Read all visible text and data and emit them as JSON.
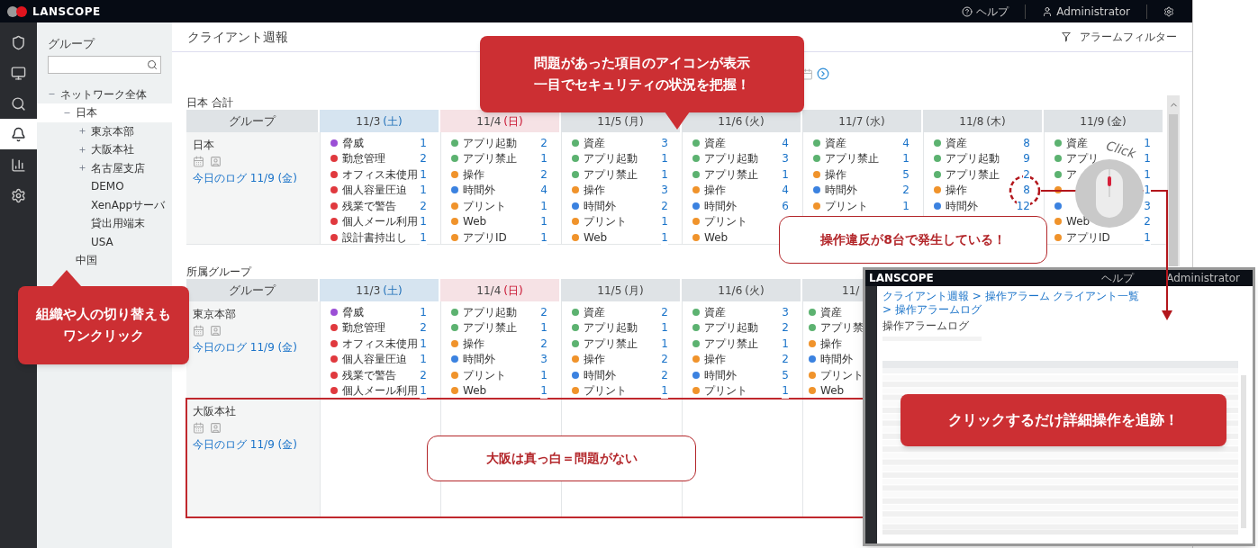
{
  "header": {
    "logo": "LANSCOPE",
    "help": "ヘルプ",
    "user": "Administrator"
  },
  "rail": [
    {
      "selected": false
    },
    {
      "selected": false
    },
    {
      "selected": false
    },
    {
      "selected": true
    },
    {
      "selected": false
    },
    {
      "selected": false
    }
  ],
  "group_panel": {
    "title": "グループ",
    "tree": [
      {
        "label": "ネットワーク全体",
        "expanded": true,
        "selected": false,
        "children": [
          {
            "label": "日本",
            "expanded": true,
            "selected": true,
            "children": [
              {
                "label": "東京本部",
                "expanded": false,
                "selected": false
              },
              {
                "label": "大阪本社",
                "expanded": false,
                "selected": false
              },
              {
                "label": "名古屋支店",
                "expanded": false,
                "selected": false
              },
              {
                "label": "DEMO",
                "selected": false
              },
              {
                "label": "XenAppサーバ",
                "selected": false
              },
              {
                "label": "貸出用端末",
                "selected": false
              },
              {
                "label": "USA",
                "selected": false
              }
            ]
          },
          {
            "label": "中国",
            "selected": false
          }
        ]
      }
    ]
  },
  "main": {
    "title": "クライアント週報",
    "filter": "アラームフィルター"
  },
  "sections": [
    {
      "title": "日本 合計",
      "group_heading": "グループ",
      "columns": [
        {
          "date": "11/3",
          "weekday": "(土)",
          "kind": "sat"
        },
        {
          "date": "11/4",
          "weekday": "(日)",
          "kind": "sun"
        },
        {
          "date": "11/5",
          "weekday": "(月)",
          "kind": "weekday"
        },
        {
          "date": "11/6",
          "weekday": "(火)",
          "kind": "weekday"
        },
        {
          "date": "11/7",
          "weekday": "(水)",
          "kind": "weekday"
        },
        {
          "date": "11/8",
          "weekday": "(木)",
          "kind": "weekday"
        },
        {
          "date": "11/9",
          "weekday": "(金)",
          "kind": "weekday"
        }
      ],
      "rows": [
        {
          "group": "日本",
          "link": "今日のログ 11/9 (金)",
          "highlighted": false,
          "cells": [
            [
              {
                "name": "脅威",
                "count": "1",
                "color": "#9b4fd6"
              },
              {
                "name": "勤怠管理",
                "count": "2",
                "color": "#e0393e"
              },
              {
                "name": "オフィス未使用",
                "count": "1",
                "color": "#e0393e"
              },
              {
                "name": "個人容量圧迫",
                "count": "1",
                "color": "#e0393e"
              },
              {
                "name": "残業で警告",
                "count": "2",
                "color": "#e0393e"
              },
              {
                "name": "個人メール利用",
                "count": "1",
                "color": "#e0393e"
              },
              {
                "name": "設計書持出し",
                "count": "1",
                "color": "#e0393e"
              }
            ],
            [
              {
                "name": "アプリ起動",
                "count": "2",
                "color": "#5cb270"
              },
              {
                "name": "アプリ禁止",
                "count": "1",
                "color": "#5cb270"
              },
              {
                "name": "操作",
                "count": "2",
                "color": "#f0932b"
              },
              {
                "name": "時間外",
                "count": "4",
                "color": "#3b82e0"
              },
              {
                "name": "プリント",
                "count": "1",
                "color": "#f0932b"
              },
              {
                "name": "Web",
                "count": "1",
                "color": "#f0932b"
              },
              {
                "name": "アプリID",
                "count": "1",
                "color": "#f0932b"
              }
            ],
            [
              {
                "name": "資産",
                "count": "3",
                "color": "#5cb270"
              },
              {
                "name": "アプリ起動",
                "count": "1",
                "color": "#5cb270"
              },
              {
                "name": "アプリ禁止",
                "count": "1",
                "color": "#5cb270"
              },
              {
                "name": "操作",
                "count": "3",
                "color": "#f0932b"
              },
              {
                "name": "時間外",
                "count": "2",
                "color": "#3b82e0"
              },
              {
                "name": "プリント",
                "count": "1",
                "color": "#f0932b"
              },
              {
                "name": "Web",
                "count": "1",
                "color": "#f0932b"
              }
            ],
            [
              {
                "name": "資産",
                "count": "4",
                "color": "#5cb270"
              },
              {
                "name": "アプリ起動",
                "count": "3",
                "color": "#5cb270"
              },
              {
                "name": "アプリ禁止",
                "count": "1",
                "color": "#5cb270"
              },
              {
                "name": "操作",
                "count": "4",
                "color": "#f0932b"
              },
              {
                "name": "時間外",
                "count": "6",
                "color": "#3b82e0"
              },
              {
                "name": "プリント",
                "color": "#f0932b"
              },
              {
                "name": "Web",
                "color": "#f0932b"
              }
            ],
            [
              {
                "name": "資産",
                "count": "4",
                "color": "#5cb270"
              },
              {
                "name": "アプリ禁止",
                "count": "1",
                "color": "#5cb270"
              },
              {
                "name": "操作",
                "count": "5",
                "color": "#f0932b"
              },
              {
                "name": "時間外",
                "count": "2",
                "color": "#3b82e0"
              },
              {
                "name": "プリント",
                "count": "1",
                "color": "#f0932b"
              }
            ],
            [
              {
                "name": "資産",
                "count": "8",
                "color": "#5cb270"
              },
              {
                "name": "アプリ起動",
                "count": "9",
                "color": "#5cb270"
              },
              {
                "name": "アプリ禁止",
                "count": "2",
                "color": "#5cb270"
              },
              {
                "name": "操作",
                "count": "8",
                "color": "#f0932b"
              },
              {
                "name": "時間外",
                "count": "12",
                "color": "#3b82e0"
              }
            ],
            [
              {
                "name": "資産",
                "count": "1",
                "color": "#5cb270"
              },
              {
                "name": "アプリ",
                "count": "1",
                "color": "#5cb270"
              },
              {
                "name": "ア",
                "count": "1",
                "color": "#5cb270"
              },
              {
                "count": "1",
                "color": "#f0932b"
              },
              {
                "count": "3",
                "color": "#3b82e0"
              },
              {
                "name": "Web",
                "count": "2",
                "color": "#f0932b"
              },
              {
                "name": "アプリID",
                "count": "1",
                "color": "#f0932b"
              }
            ]
          ]
        }
      ]
    },
    {
      "title": "所属グループ",
      "group_heading": "グループ",
      "columns": [
        {
          "date": "11/3",
          "weekday": "(土)",
          "kind": "sat"
        },
        {
          "date": "11/4",
          "weekday": "(日)",
          "kind": "sun"
        },
        {
          "date": "11/5",
          "weekday": "(月)",
          "kind": "weekday"
        },
        {
          "date": "11/6",
          "weekday": "(火)",
          "kind": "weekday"
        },
        {
          "date": "11/",
          "kind": "cut"
        }
      ],
      "rows": [
        {
          "group": "東京本部",
          "link": "今日のログ 11/9 (金)",
          "highlighted": false,
          "cells": [
            [
              {
                "name": "脅威",
                "count": "1",
                "color": "#9b4fd6"
              },
              {
                "name": "勤怠管理",
                "count": "2",
                "color": "#e0393e"
              },
              {
                "name": "オフィス未使用",
                "count": "1",
                "color": "#e0393e"
              },
              {
                "name": "個人容量圧迫",
                "count": "1",
                "color": "#e0393e"
              },
              {
                "name": "残業で警告",
                "count": "2",
                "color": "#e0393e"
              },
              {
                "name": "個人メール利用",
                "count": "1",
                "color": "#e0393e"
              }
            ],
            [
              {
                "name": "アプリ起動",
                "count": "2",
                "color": "#5cb270"
              },
              {
                "name": "アプリ禁止",
                "count": "1",
                "color": "#5cb270"
              },
              {
                "name": "操作",
                "count": "2",
                "color": "#f0932b"
              },
              {
                "name": "時間外",
                "count": "3",
                "color": "#3b82e0"
              },
              {
                "name": "プリント",
                "count": "1",
                "color": "#f0932b"
              },
              {
                "name": "Web",
                "count": "1",
                "color": "#f0932b"
              }
            ],
            [
              {
                "name": "資産",
                "count": "2",
                "color": "#5cb270"
              },
              {
                "name": "アプリ起動",
                "count": "1",
                "color": "#5cb270"
              },
              {
                "name": "アプリ禁止",
                "count": "1",
                "color": "#5cb270"
              },
              {
                "name": "操作",
                "count": "2",
                "color": "#f0932b"
              },
              {
                "name": "時間外",
                "count": "2",
                "color": "#3b82e0"
              },
              {
                "name": "プリント",
                "count": "1",
                "color": "#f0932b"
              }
            ],
            [
              {
                "name": "資産",
                "count": "3",
                "color": "#5cb270"
              },
              {
                "name": "アプリ起動",
                "count": "2",
                "color": "#5cb270"
              },
              {
                "name": "アプリ禁止",
                "count": "1",
                "color": "#5cb270"
              },
              {
                "name": "操作",
                "count": "2",
                "color": "#f0932b"
              },
              {
                "name": "時間外",
                "count": "5",
                "color": "#3b82e0"
              },
              {
                "name": "プリント",
                "count": "1",
                "color": "#f0932b"
              }
            ],
            [
              {
                "name": "資産",
                "color": "#5cb270"
              },
              {
                "name": "アプリ禁",
                "color": "#5cb270"
              },
              {
                "name": "操作",
                "color": "#f0932b"
              },
              {
                "name": "時間外",
                "color": "#3b82e0"
              },
              {
                "name": "プリント",
                "color": "#f0932b"
              },
              {
                "name": "Web",
                "color": "#f0932b"
              }
            ]
          ]
        },
        {
          "group": "大阪本社",
          "link": "今日のログ 11/9 (金)",
          "highlighted": true,
          "cells": [
            [],
            [],
            [],
            [],
            []
          ]
        }
      ]
    }
  ],
  "callouts": [
    {
      "kind": "red",
      "lines": [
        "問題があった項目のアイコンが表示",
        "一目でセキュリティの状況を把握！"
      ]
    },
    {
      "kind": "red",
      "lines": [
        "組織や人の切り替えも",
        "ワンクリック"
      ]
    },
    {
      "kind": "outline",
      "lines": [
        "操作違反が8台で発生している！"
      ]
    },
    {
      "kind": "outline",
      "lines": [
        "大阪は真っ白＝問題がない"
      ]
    },
    {
      "kind": "red",
      "lines": [
        "クリックするだけ詳細操作を追跡！"
      ]
    }
  ],
  "click_label": "Click",
  "inset": {
    "logo": "LANSCOPE",
    "help": "ヘルプ",
    "user": "Administrator",
    "breadcrumb": "クライアント週報 > 操作アラーム クライアント一覧 > 操作アラームログ",
    "title": "操作アラームログ"
  }
}
